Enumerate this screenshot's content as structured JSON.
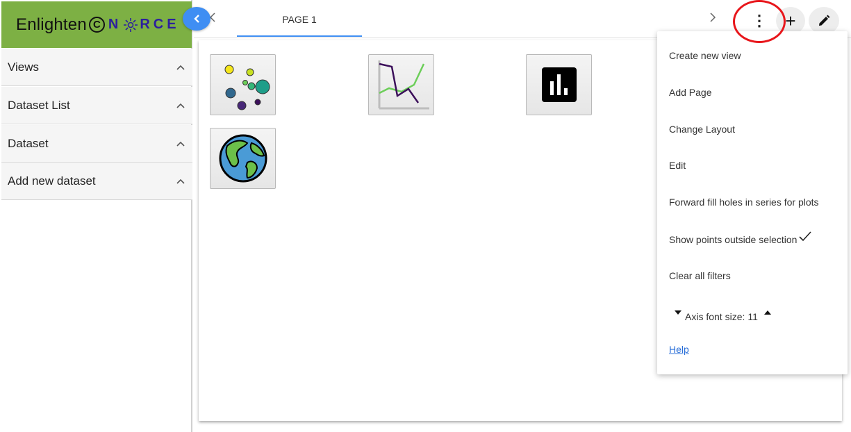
{
  "brand": {
    "name": "Enlighten",
    "copyright_symbol": "C",
    "partner_logo_text": "NORCE",
    "colors": {
      "bar": "#7db044",
      "partner": "#2c1f9e"
    }
  },
  "sidebar": {
    "collapse_icon": "chevron-left-icon",
    "items": [
      {
        "label": "Views",
        "icon": "chevron-up-icon"
      },
      {
        "label": "Dataset List",
        "icon": "chevron-up-icon"
      },
      {
        "label": "Dataset",
        "icon": "chevron-up-icon"
      },
      {
        "label": "Add new dataset",
        "icon": "chevron-up-icon"
      }
    ]
  },
  "tabs": {
    "prev_icon": "chevron-left-icon",
    "next_icon": "chevron-right-icon",
    "items": [
      {
        "label": "PAGE 1",
        "active": true
      }
    ],
    "accent": "#3f8ef3"
  },
  "toolbar": {
    "more_icon": "more-vertical-icon",
    "add_icon": "plus-icon",
    "edit_icon": "pencil-icon",
    "more_glyph": "⋮",
    "add_glyph": "+"
  },
  "views": [
    {
      "icon": "scatter-plot-icon"
    },
    {
      "icon": "line-chart-icon"
    },
    {
      "icon": "bar-chart-icon"
    },
    {
      "icon": "globe-map-icon"
    }
  ],
  "menu": {
    "items": [
      {
        "label": "Create new view"
      },
      {
        "label": "Add Page"
      },
      {
        "label": "Change Layout"
      },
      {
        "label": "Edit"
      },
      {
        "label": "Forward fill holes in series for plots"
      },
      {
        "label": "Show points outside selection",
        "checked": true
      },
      {
        "label": "Clear all filters"
      }
    ],
    "font_size": {
      "label": "Axis font size:",
      "value": "11",
      "decrease_icon": "caret-down-icon",
      "increase_icon": "caret-up-icon"
    },
    "help_label": "Help",
    "check_icon": "checkmark-icon"
  },
  "annotation": {
    "color": "#e8161b"
  }
}
